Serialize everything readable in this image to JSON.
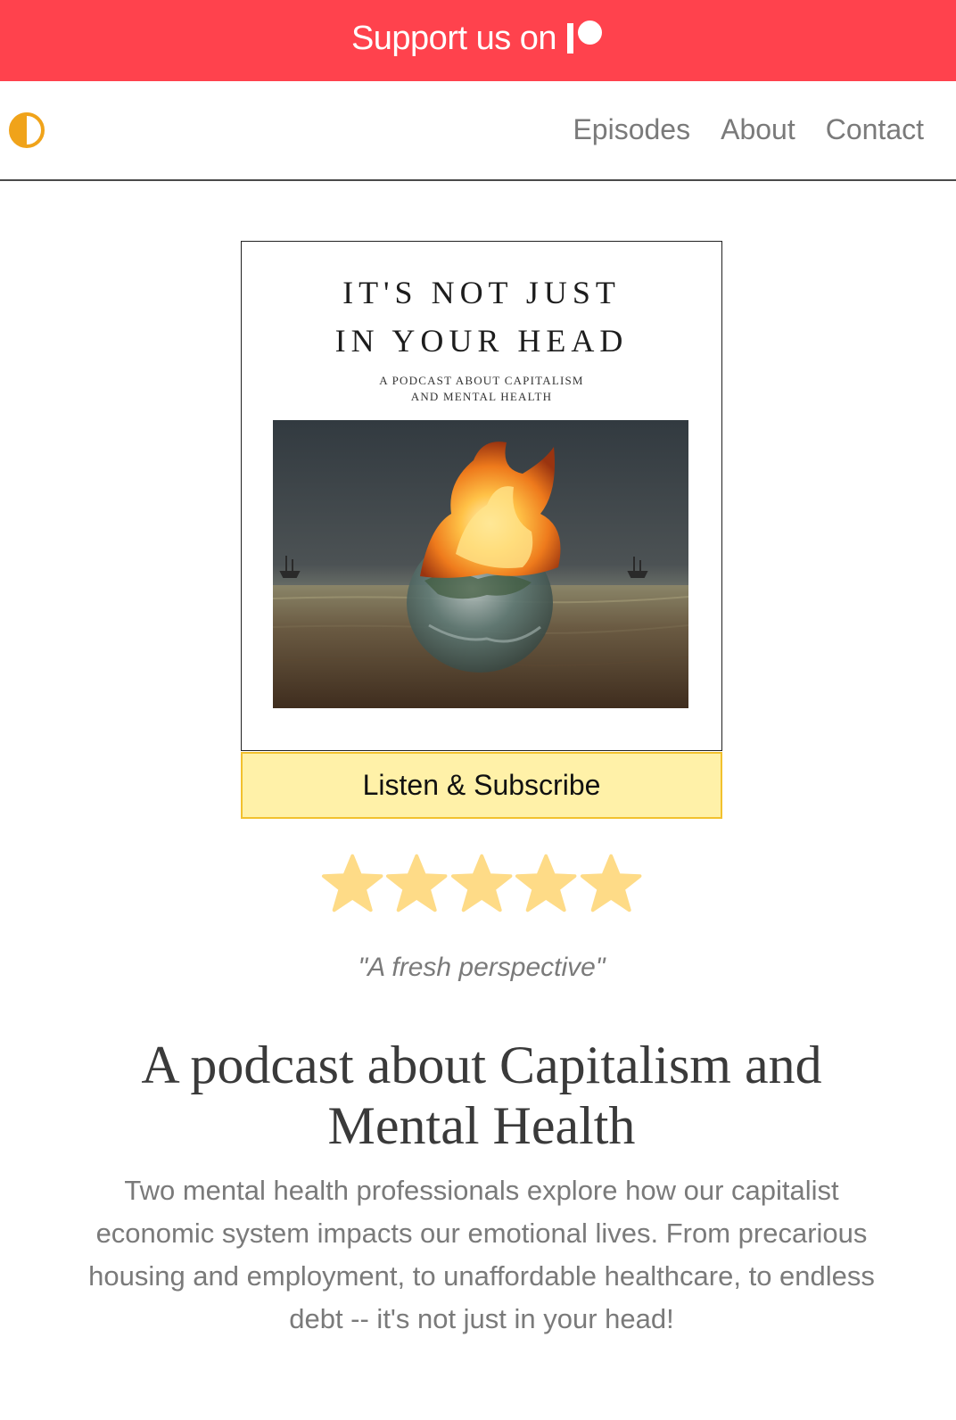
{
  "banner": {
    "text": "Support us on",
    "logo_icon": "patreon-icon",
    "bg_color": "#ff424d"
  },
  "nav": {
    "toggle_icon": "theme-toggle-icon",
    "links": [
      "Episodes",
      "About",
      "Contact"
    ]
  },
  "cover": {
    "title_line1": "IT'S NOT JUST",
    "title_line2": "IN YOUR HEAD",
    "subtitle_line1": "A PODCAST ABOUT CAPITALISM",
    "subtitle_line2": "AND MENTAL HEALTH",
    "image": "burning-globe-in-sea-image"
  },
  "listen_button": {
    "label": "Listen & Subscribe",
    "bg_color": "#fff1a8",
    "border_color": "#f2c12e"
  },
  "rating": {
    "stars": 5,
    "max": 5,
    "star_color": "#fedb87"
  },
  "review": {
    "quote": "\"A fresh perspective\""
  },
  "hero": {
    "headline": "A podcast about Capitalism and Mental Health",
    "description": "Two mental health professionals explore how our capitalist economic system impacts our emotional lives. From precarious housing and employment, to unaffordable healthcare, to endless debt -- it's not just in your head!"
  }
}
